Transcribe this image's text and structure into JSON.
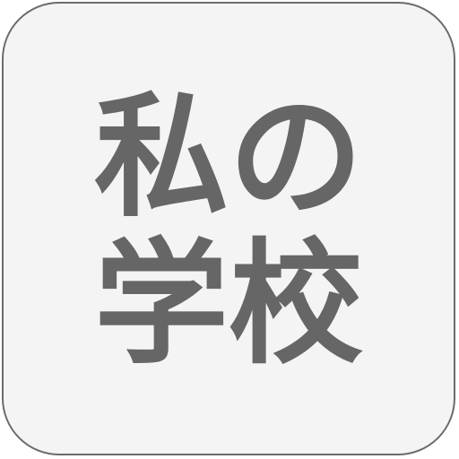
{
  "app_icon": {
    "line_1": "私の",
    "line_2": "学校"
  },
  "colors": {
    "background": "#f4f4f4",
    "border": "#6b6b6b",
    "text": "#666666"
  }
}
